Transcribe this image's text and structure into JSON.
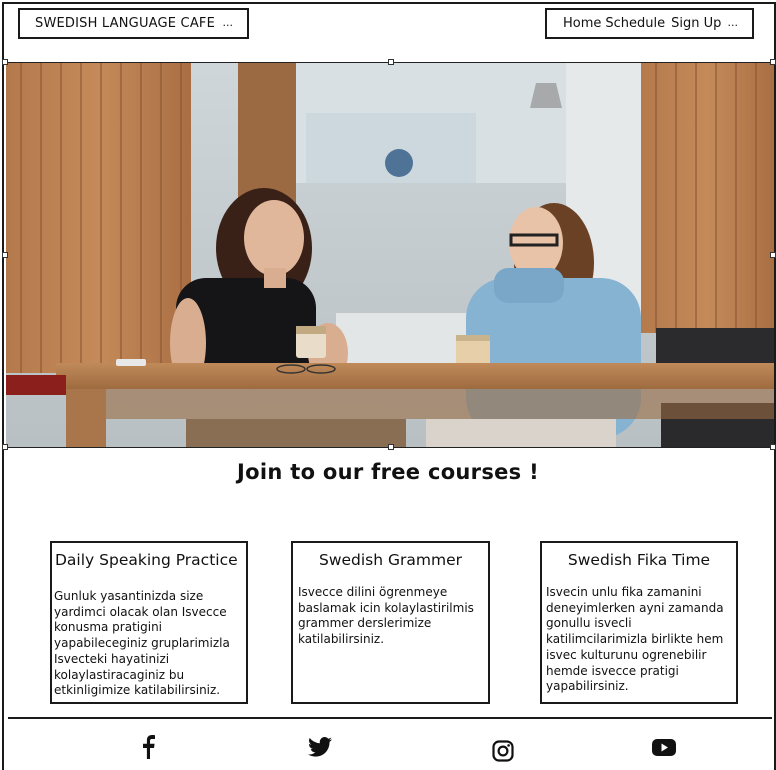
{
  "header": {
    "brand": "SWEDISH LANGUAGE CAFE",
    "brand_menu": "...",
    "nav": [
      "Home",
      "Schedule",
      "Sign Up"
    ],
    "nav_menu": "..."
  },
  "main": {
    "headline": "Join  to our free courses !",
    "cards": [
      {
        "title": "Daily Speaking Practice",
        "text": "Gunluk yasantinizda size yardimci olacak olan Isvecce konusma pratigini yapabileceginiz gruplarimizla Isvecteki hayatinizi kolaylastiracaginiz bu etkinligimize katilabilirsiniz."
      },
      {
        "title": "Swedish Grammer",
        "text": "Isvecce dilini ögrenmeye baslamak icin kolaylastirilmis grammer derslerimize katilabilirsiniz."
      },
      {
        "title": "Swedish Fika Time",
        "text": "Isvecin unlu fika zamanini deneyimlerken ayni zamanda gonullu isvecli katilimcilarimizla birlikte hem isvec kulturunu ogrenebilir hemde isvecce pratigi yapabilirsiniz."
      }
    ]
  },
  "footer": {
    "social": [
      "facebook-icon",
      "twitter-icon",
      "instagram-icon",
      "youtube-icon"
    ]
  },
  "colors": {
    "line": "#1a1a1a",
    "background": "#ffffff"
  }
}
